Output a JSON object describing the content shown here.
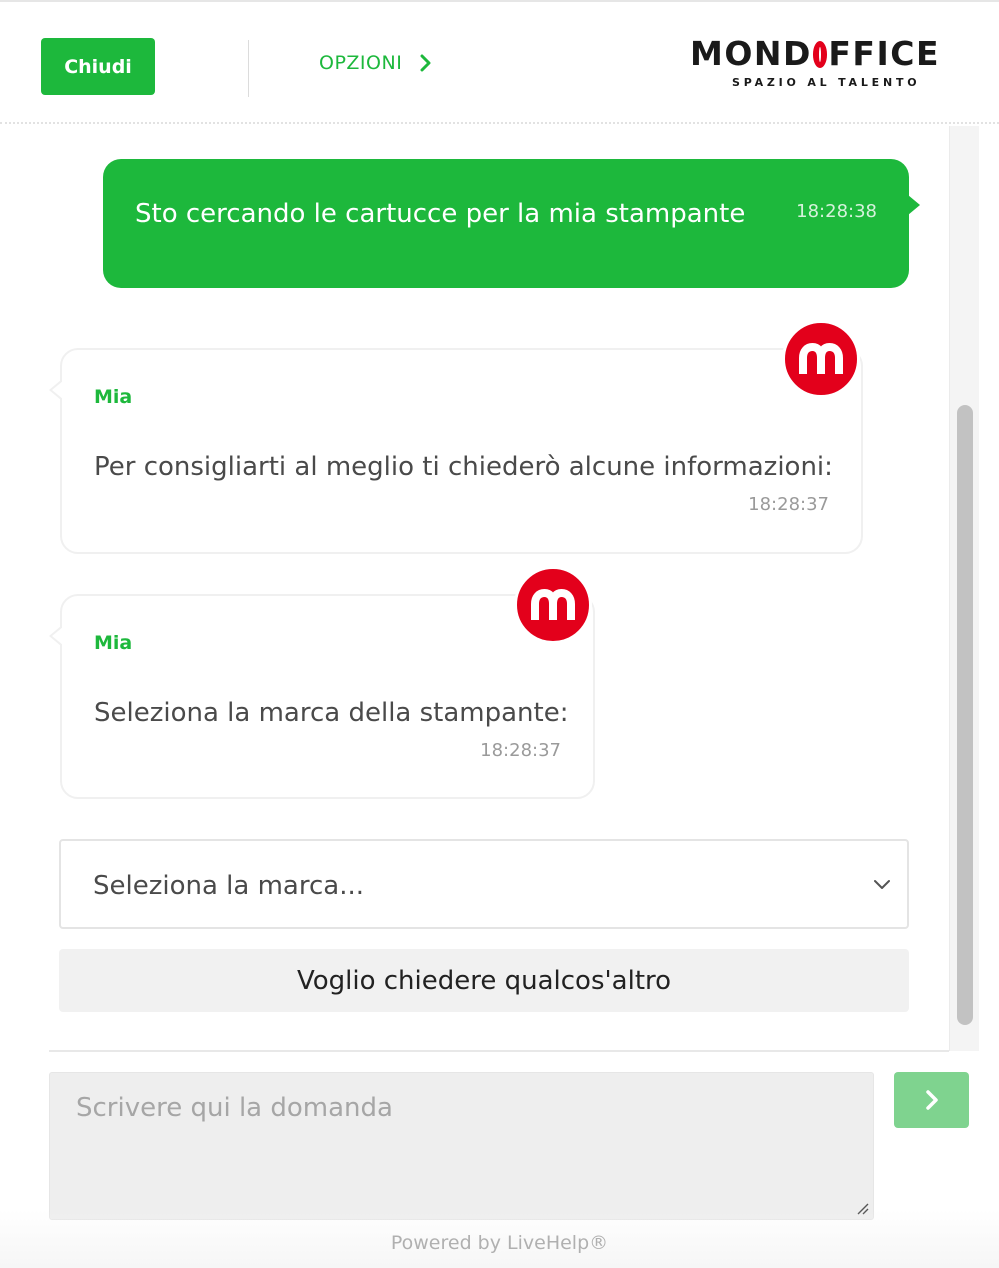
{
  "header": {
    "close_label": "Chiudi",
    "options_label": "OPZIONI",
    "logo": {
      "wordmark": "MONDOFFICE",
      "wordmark_before_o": "MOND",
      "wordmark_after_o": "FFICE",
      "tagline": "SPAZIO AL TALENTO"
    }
  },
  "messages": [
    {
      "from": "user",
      "text": "Sto cercando le cartucce per la mia stampante",
      "time": "18:28:38"
    },
    {
      "from": "bot",
      "sender": "Mia",
      "avatar_letter": "m",
      "text": "Per consigliarti al meglio ti chiederò alcune informazioni:",
      "time": "18:28:37"
    },
    {
      "from": "bot",
      "sender": "Mia",
      "avatar_letter": "m",
      "text": "Seleziona la marca della stampante:",
      "time": "18:28:37"
    }
  ],
  "brand_select": {
    "selected": "Seleziona la marca..."
  },
  "ask_other_label": "Voglio chiedere qualcos'altro",
  "input": {
    "placeholder": "Scrivere qui la domanda"
  },
  "footer": {
    "powered_by": "Powered by LiveHelp®"
  },
  "colors": {
    "accent_green": "#1db83c",
    "send_button_disabled": "#7fd38f",
    "brand_red": "#e3001b"
  },
  "icons": {
    "options": "chevron-right-icon",
    "select": "chevron-down-icon",
    "send": "chevron-right-icon",
    "avatar": "mondoffice-m-logo"
  }
}
